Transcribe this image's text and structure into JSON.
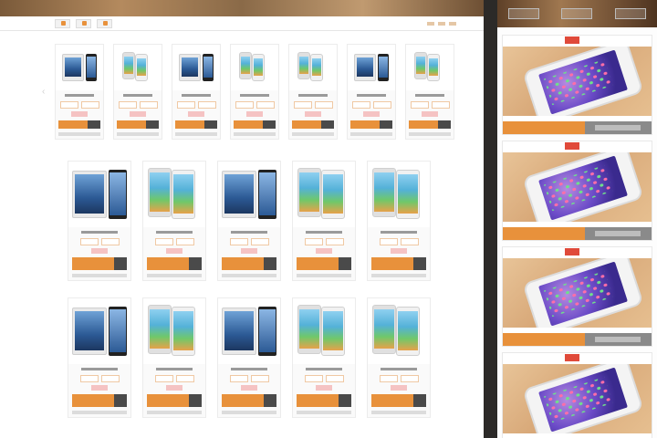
{
  "nav": {
    "items": [
      "",
      "",
      ""
    ]
  },
  "left": {
    "rows": [
      {
        "cards": [
          "ipad",
          "iphone",
          "ipad",
          "iphone",
          "iphone",
          "ipad",
          "iphone"
        ]
      },
      {
        "cards": [
          "ipad",
          "iphone",
          "ipad",
          "iphone",
          "iphone"
        ]
      },
      {
        "cards": [
          "ipad",
          "iphone",
          "ipad",
          "iphone",
          "iphone"
        ]
      }
    ]
  },
  "right": {
    "tabs": [
      "",
      "",
      ""
    ],
    "promos": [
      {
        "header": "",
        "badge": ""
      },
      {
        "header": "",
        "badge": ""
      },
      {
        "header": "",
        "badge": ""
      },
      {
        "header": "",
        "badge": ""
      }
    ]
  },
  "colors": {
    "accent": "#e8913b",
    "badge": "#e04a3a",
    "dark": "#2c2a28"
  }
}
